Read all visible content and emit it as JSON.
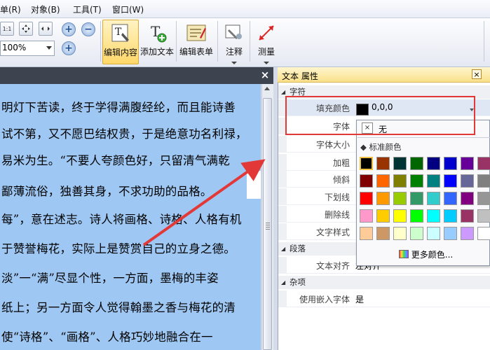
{
  "menu": {
    "items": [
      {
        "label": "单(R)"
      },
      {
        "label": "对象(B)"
      },
      {
        "label": "工具(T)"
      },
      {
        "label": "窗口(W)"
      }
    ]
  },
  "toolbar": {
    "zoom_value": "100%",
    "actual_size_label": "1:1",
    "zoom_in_symbol": "+",
    "zoom_out_symbol": "−",
    "zoom_add_symbol": "+",
    "buttons": [
      {
        "label": "编辑内容",
        "active": true
      },
      {
        "label": "添加文本",
        "active": false
      },
      {
        "label": "编辑表单",
        "active": false
      },
      {
        "label": "注释",
        "active": false
      },
      {
        "label": "测量",
        "active": false
      }
    ]
  },
  "document": {
    "close_symbol": "×",
    "lines": [
      "明灯下苦读，终于学得满腹经纶，而且能诗善",
      "试不第，又不愿巴结权贵，于是绝意功名利禄，",
      "易米为生。“不要人夸颜色好，只留清气满乾",
      "鄙薄流俗，独善其身，不求功助的品格。",
      "每”，意在述志。诗人将画格、诗格、人格有机",
      "于赞誉梅花，实际上是赞赏自己的立身之德。",
      "淡”一“满”尽显个性，一方面，墨梅的丰姿",
      "纸上；另一方面令人觉得翰墨之香与梅花的清",
      "使“诗格”、“画格”、人格巧妙地融合在一"
    ]
  },
  "properties": {
    "title": "文本 属性",
    "close_symbol": "×",
    "categories": {
      "char": "字符",
      "para": "段落",
      "misc": "杂项"
    },
    "rows": {
      "fill_color": {
        "label": "填充颜色",
        "value": "0,0,0"
      },
      "font": {
        "label": "字体"
      },
      "font_size": {
        "label": "字体大小"
      },
      "bold": {
        "label": "加粗"
      },
      "italic": {
        "label": "倾斜"
      },
      "underline": {
        "label": "下划线"
      },
      "strikethrough": {
        "label": "删除线"
      },
      "text_style": {
        "label": "文字样式"
      },
      "text_align": {
        "label": "文本对齐",
        "value": "左对齐"
      },
      "embed_font": {
        "label": "使用嵌入字体",
        "value": "是"
      }
    },
    "fill_color_hex": "#000000"
  },
  "color_picker": {
    "no_color_symbol": "×",
    "no_color_label": "无",
    "standard_colors_label": "标准颜色",
    "more_colors_label": "更多颜色...",
    "selected_color": "#000000",
    "colors": [
      [
        "#000000",
        "#993300",
        "#003333",
        "#006600",
        "#000080",
        "#0000cc",
        "#660099",
        "#993366"
      ],
      [
        "#800000",
        "#ff6600",
        "#808000",
        "#008000",
        "#008080",
        "#0000ff",
        "#666699",
        "#808080"
      ],
      [
        "#ff0000",
        "#ff9900",
        "#99cc00",
        "#339966",
        "#33cccc",
        "#3366ff",
        "#800080",
        "#969696"
      ],
      [
        "#ff99cc",
        "#ffcc00",
        "#ffff00",
        "#00ff00",
        "#00ffff",
        "#00ccff",
        "#993366",
        "#c0c0c0"
      ],
      [
        "#ffcc99",
        "#cc9966",
        "#ffffcc",
        "#ccffcc",
        "#ccffff",
        "#99ccff",
        "#cc99ff",
        "#ffffff"
      ]
    ]
  },
  "annotation": {
    "highlight_color": "#e33838"
  }
}
